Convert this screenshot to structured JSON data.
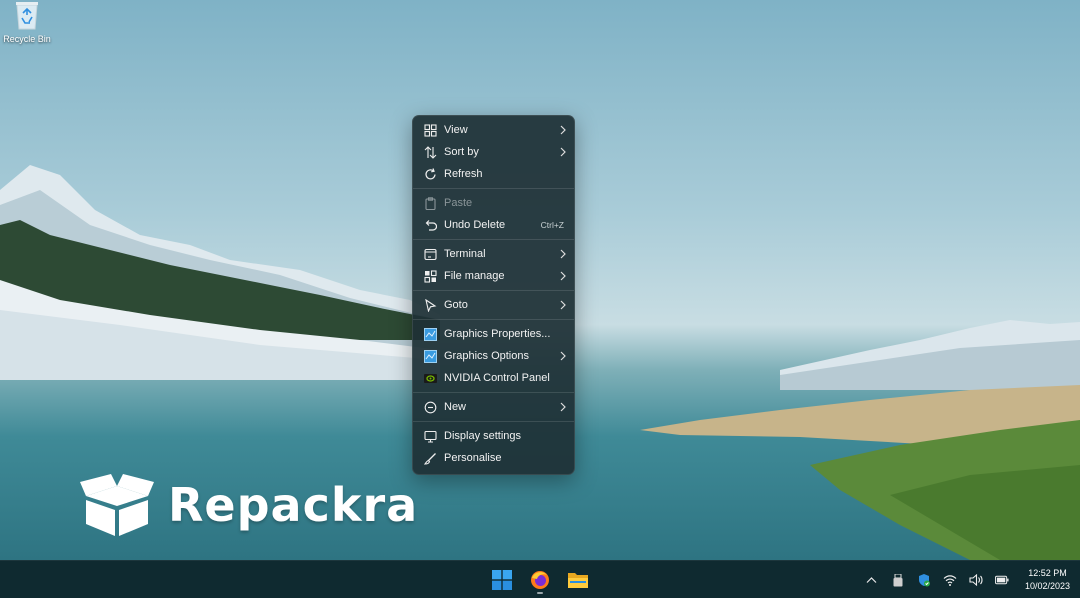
{
  "desktop": {
    "recycle_bin_label": "Recycle Bin",
    "watermark_text": "Repackra"
  },
  "context_menu": {
    "items": [
      {
        "label": "View",
        "icon": "grid-icon",
        "submenu": true
      },
      {
        "label": "Sort by",
        "icon": "sort-icon",
        "submenu": true
      },
      {
        "label": "Refresh",
        "icon": "refresh-icon",
        "submenu": false
      },
      {
        "label": "Paste",
        "icon": "clipboard-icon",
        "disabled": true
      },
      {
        "label": "Undo Delete",
        "icon": "undo-icon",
        "shortcut": "Ctrl+Z"
      },
      {
        "label": "Terminal",
        "icon": "terminal-icon",
        "submenu": true
      },
      {
        "label": "File manage",
        "icon": "file-manage-icon",
        "submenu": true
      },
      {
        "label": "Goto",
        "icon": "cursor-icon",
        "submenu": true
      },
      {
        "label": "Graphics Properties...",
        "icon": "intel-graphics-icon"
      },
      {
        "label": "Graphics Options",
        "icon": "intel-graphics-icon",
        "submenu": true
      },
      {
        "label": "NVIDIA Control Panel",
        "icon": "nvidia-icon"
      },
      {
        "label": "New",
        "icon": "new-icon",
        "submenu": true
      },
      {
        "label": "Display settings",
        "icon": "display-icon"
      },
      {
        "label": "Personalise",
        "icon": "brush-icon"
      }
    ]
  },
  "taskbar": {
    "apps": [
      "windows-start-icon",
      "firefox-icon",
      "file-explorer-icon"
    ],
    "tray": [
      "chevron-up-icon",
      "usb-drive-icon",
      "security-shield-icon",
      "wifi-icon",
      "volume-icon",
      "battery-icon"
    ],
    "clock": {
      "time": "12:52 PM",
      "date": "10/02/2023"
    }
  },
  "colors": {
    "menu_bg": "#1e3036",
    "taskbar_bg": "#0f2a30",
    "accent_blue": "#2f8fe0",
    "nvidia_green": "#76b900"
  }
}
